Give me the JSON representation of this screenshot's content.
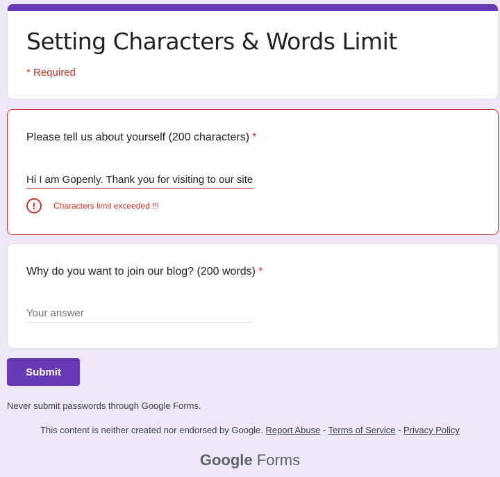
{
  "form": {
    "title": "Setting Characters & Words Limit",
    "required_note": "* Required"
  },
  "questions": [
    {
      "title": "Please tell us about yourself (200 characters)",
      "required_mark": "*",
      "value": "Hi I am Gopenly. Thank you for visiting to our site",
      "error": "Characters limit exceeded !!!"
    },
    {
      "title": "Why do you want to join our blog? (200 words)",
      "required_mark": "*",
      "placeholder": "Your answer"
    }
  ],
  "submit_label": "Submit",
  "footer": {
    "warning": "Never submit passwords through Google Forms.",
    "disclaimer": "This content is neither created nor endorsed by Google.",
    "report_abuse": "Report Abuse",
    "sep1": " - ",
    "terms": "Terms of Service",
    "sep2": " - ",
    "privacy": "Privacy Policy",
    "brand": "Google",
    "product": "Forms"
  },
  "colors": {
    "accent": "#673ab7",
    "error": "#d93025",
    "background": "#ede7f6"
  },
  "icons": {
    "error": "error-exclamation-icon"
  }
}
